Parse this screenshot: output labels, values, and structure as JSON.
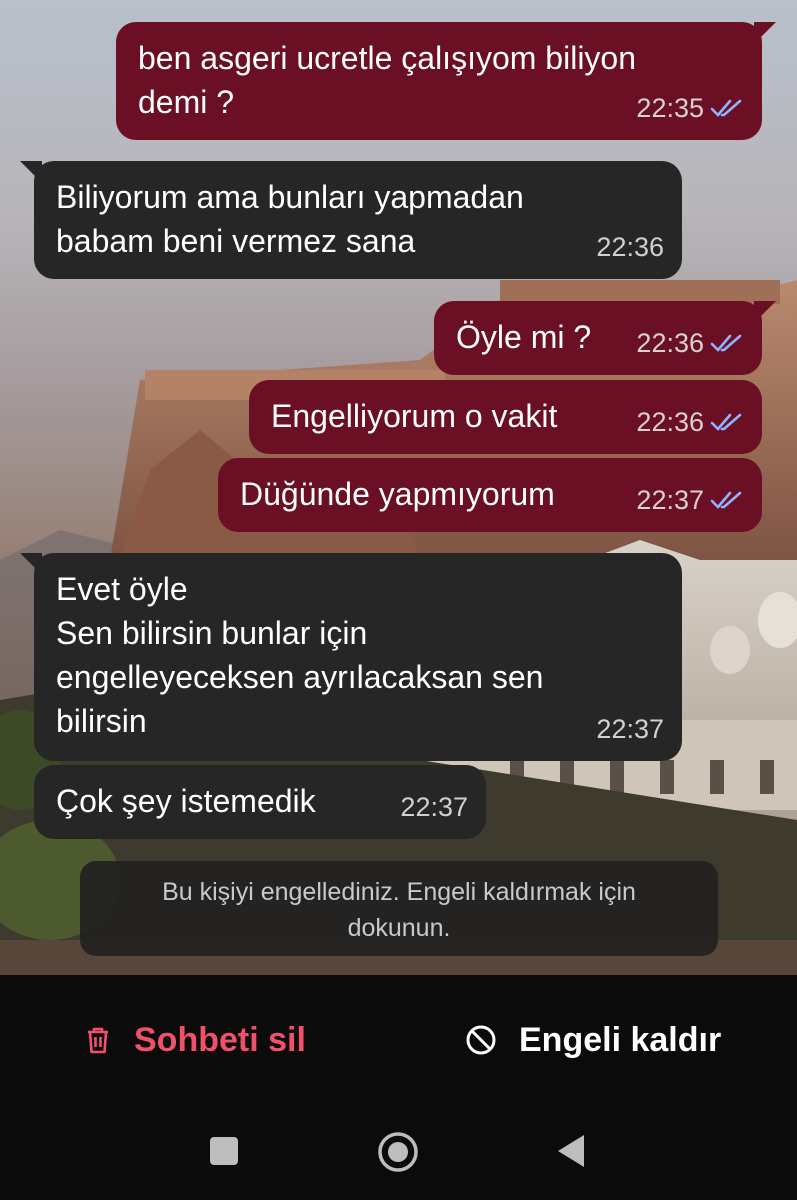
{
  "messages": [
    {
      "dir": "out",
      "text": "ben asgeri ucretle çalışıyom biliyon\ndemi ?",
      "time": "22:35",
      "status": "read"
    },
    {
      "dir": "in",
      "text": "Biliyorum ama bunları yapmadan\nbabam beni vermez sana",
      "time": "22:36"
    },
    {
      "dir": "out",
      "text": "Öyle mi ?",
      "time": "22:36",
      "status": "read"
    },
    {
      "dir": "out",
      "text": "Engelliyorum o vakit",
      "time": "22:36",
      "status": "read"
    },
    {
      "dir": "out",
      "text": "Düğünde yapmıyorum",
      "time": "22:37",
      "status": "read"
    },
    {
      "dir": "in",
      "text": "Evet öyle\nSen bilirsin bunlar için\nengelleyeceksen ayrılacaksan sen\nbilirsin",
      "time": "22:37"
    },
    {
      "dir": "in",
      "text": "Çok şey istemedik",
      "time": "22:37"
    }
  ],
  "blocked_notice": "Bu kişiyi engellediniz. Engeli kaldırmak için dokunun.",
  "actions": {
    "delete_label": "Sohbeti sil",
    "unblock_label": "Engeli kaldır"
  },
  "colors": {
    "outgoing_bubble": "#6b0f24",
    "incoming_bubble": "#262626",
    "read_tick": "#8fb4ff",
    "delete_accent": "#f0506a"
  },
  "icons": {
    "delete": "trash-icon",
    "unblock": "block-icon",
    "nav_recents": "square-icon",
    "nav_home": "circle-icon",
    "nav_back": "triangle-back-icon"
  }
}
